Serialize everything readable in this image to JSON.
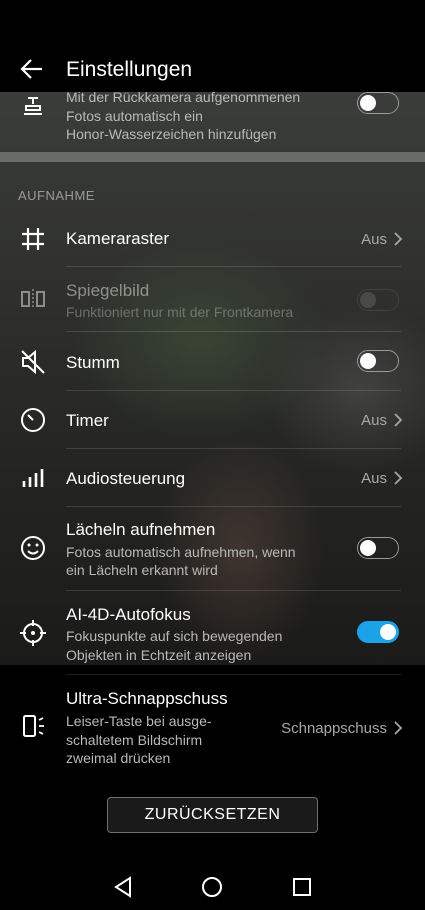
{
  "header": {
    "title": "Einstellungen"
  },
  "watermark_row": {
    "subtitle_lines": [
      "Mit der Rückkamera aufgenommenen",
      "Fotos automatisch ein",
      "Honor-Wasserzeichen hinzufügen"
    ]
  },
  "section": {
    "label": "AUFNAHME"
  },
  "rows": {
    "grid": {
      "label": "Kameraraster",
      "value": "Aus"
    },
    "mirror": {
      "label": "Spiegelbild",
      "subtitle": "Funktioniert nur mit der Frontkamera"
    },
    "mute": {
      "label": "Stumm"
    },
    "timer": {
      "label": "Timer",
      "value": "Aus"
    },
    "audio": {
      "label": "Audiosteuerung",
      "value": "Aus"
    },
    "smile": {
      "label": "Lächeln aufnehmen",
      "subtitle_lines": [
        "Fotos automatisch aufnehmen, wenn",
        "ein Lächeln erkannt wird"
      ]
    },
    "af": {
      "label": "AI-4D-Autofokus",
      "subtitle_lines": [
        "Fokuspunkte auf sich bewegenden",
        "Objekten in Echtzeit anzeigen"
      ]
    },
    "snap": {
      "label": "Ultra-Schnappschuss",
      "subtitle_lines": [
        "Leiser-Taste bei ausge-",
        "schaltetem Bildschirm",
        "zweimal drücken"
      ],
      "value": "Schnappschuss"
    }
  },
  "toggles": {
    "watermark": false,
    "mirror": false,
    "mute": false,
    "smile": false,
    "af": true
  },
  "reset_button": {
    "label": "ZURÜCKSETZEN"
  },
  "colors": {
    "accent": "#1aa3e8",
    "background": "#000000"
  }
}
